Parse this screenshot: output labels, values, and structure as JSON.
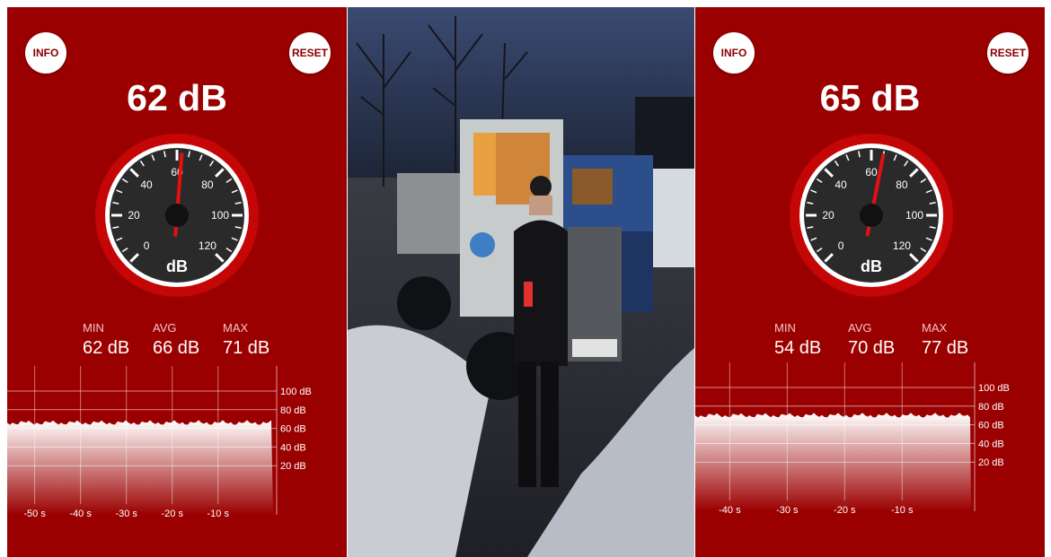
{
  "colors": {
    "panel_bg": "#9b0000",
    "gauge_face": "#2a2a2a",
    "needle": "#e31010",
    "button_text": "#8a0000"
  },
  "left": {
    "info_label": "INFO",
    "reset_label": "RESET",
    "reading": "62 dB",
    "gauge": {
      "value": 62,
      "min": 0,
      "max": 120,
      "unit": "dB",
      "ticks": [
        "0",
        "20",
        "40",
        "60",
        "80",
        "100",
        "120"
      ]
    },
    "stats": {
      "min_label": "MIN",
      "min_value": "62 dB",
      "avg_label": "AVG",
      "avg_value": "66 dB",
      "max_label": "MAX",
      "max_value": "71 dB"
    },
    "chart_data": {
      "type": "area",
      "y_ticks": [
        "100 dB",
        "80 dB",
        "60 dB",
        "40 dB",
        "20 dB"
      ],
      "x_ticks": [
        "-50 s",
        "-40 s",
        "-30 s",
        "-20 s",
        "-10 s"
      ],
      "ylim": [
        0,
        100
      ],
      "level": 66
    }
  },
  "right": {
    "info_label": "INFO",
    "reset_label": "RESET",
    "reading": "65 dB",
    "gauge": {
      "value": 65,
      "min": 0,
      "max": 120,
      "unit": "dB",
      "ticks": [
        "0",
        "20",
        "40",
        "60",
        "80",
        "100",
        "120"
      ]
    },
    "stats": {
      "min_label": "MIN",
      "min_value": "54 dB",
      "avg_label": "AVG",
      "avg_value": "70 dB",
      "max_label": "MAX",
      "max_value": "77 dB"
    },
    "chart_data": {
      "type": "area",
      "y_ticks": [
        "100 dB",
        "80 dB",
        "60 dB",
        "40 dB",
        "20 dB"
      ],
      "x_ticks": [
        "-40 s",
        "-30 s",
        "-20 s",
        "-10 s"
      ],
      "ylim": [
        0,
        100
      ],
      "level": 70
    }
  }
}
